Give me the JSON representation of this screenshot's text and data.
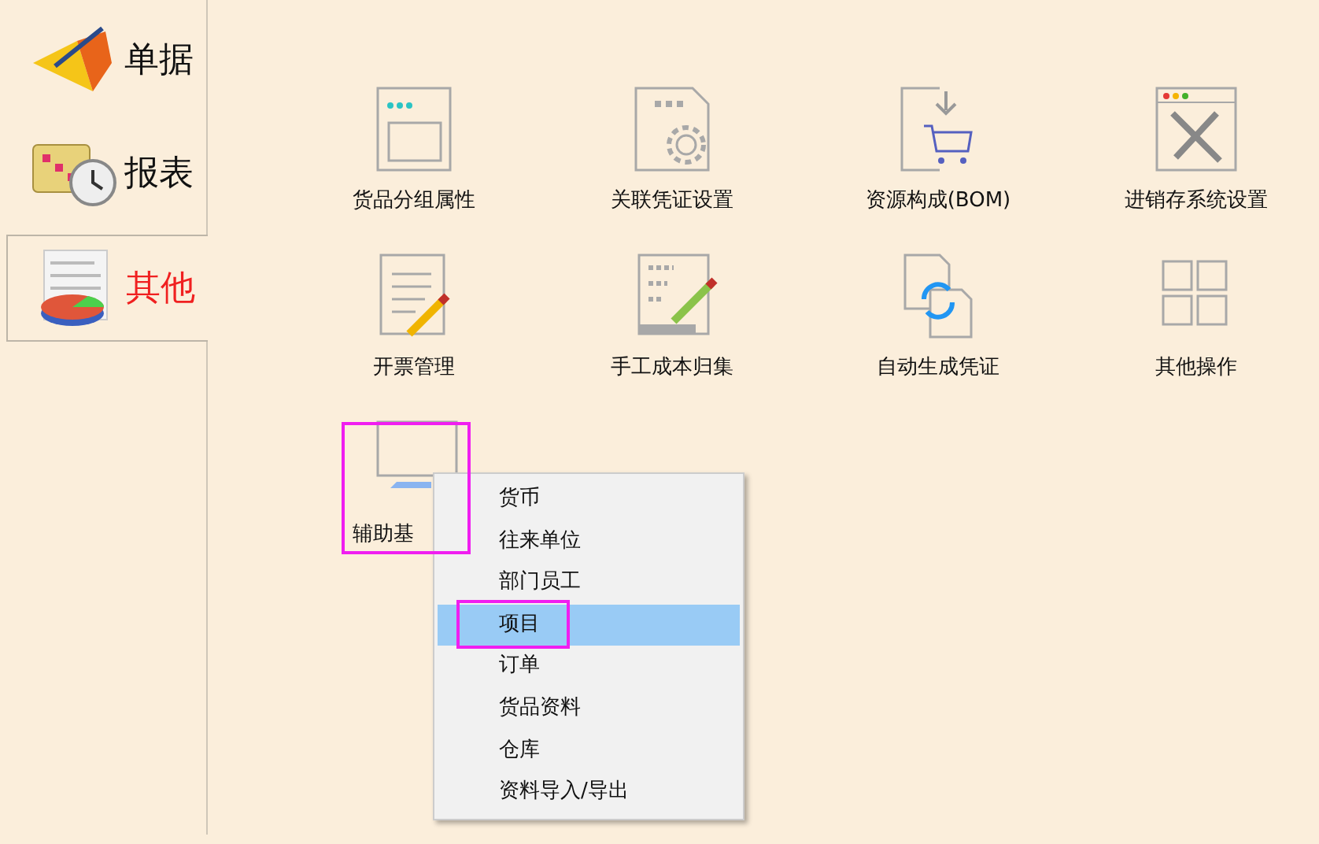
{
  "sidebar": {
    "items": [
      {
        "label": "单据",
        "kind": "folder",
        "selected": false
      },
      {
        "label": "报表",
        "kind": "calendar",
        "selected": false
      },
      {
        "label": "其他",
        "kind": "chart",
        "selected": true
      }
    ]
  },
  "tiles": [
    {
      "label": "货品分组属性",
      "kind": "window"
    },
    {
      "label": "关联凭证设置",
      "kind": "settings"
    },
    {
      "label": "资源构成(BOM)",
      "kind": "cart"
    },
    {
      "label": "进销存系统设置",
      "kind": "tools"
    },
    {
      "label": "开票管理",
      "kind": "note"
    },
    {
      "label": "手工成本归集",
      "kind": "list"
    },
    {
      "label": "自动生成凭证",
      "kind": "sync"
    },
    {
      "label": "其他操作",
      "kind": "grid"
    },
    {
      "label": "辅助基",
      "kind": "monitor"
    }
  ],
  "context_menu": {
    "items": [
      {
        "label": "货币",
        "selected": false
      },
      {
        "label": "往来单位",
        "selected": false
      },
      {
        "label": "部门员工",
        "selected": false
      },
      {
        "label": "项目",
        "selected": true
      },
      {
        "label": "订单",
        "selected": false
      },
      {
        "label": "货品资料",
        "selected": false
      },
      {
        "label": "仓库",
        "selected": false
      },
      {
        "label": "资料导入/导出",
        "selected": false
      }
    ]
  }
}
